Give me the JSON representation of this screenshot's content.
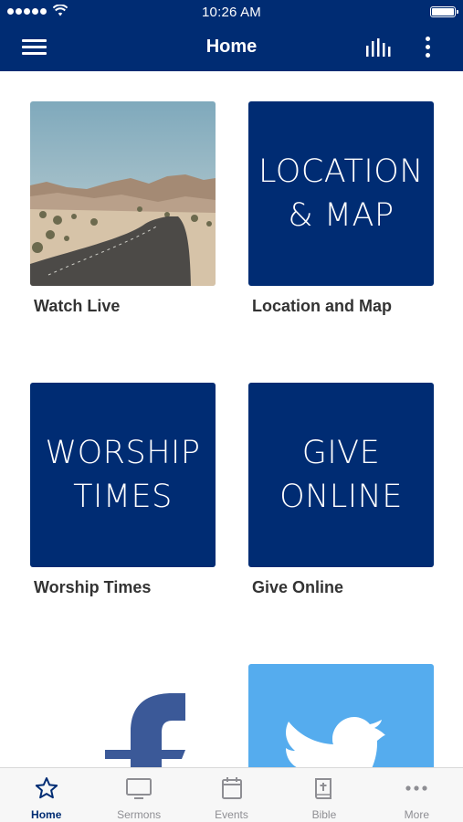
{
  "status_bar": {
    "time": "10:26 AM"
  },
  "nav": {
    "title": "Home"
  },
  "tiles": [
    {
      "label": "Watch Live",
      "image": "desert-road-photo"
    },
    {
      "label": "Location and Map",
      "text": "LOCATION\n& MAP"
    },
    {
      "label": "Worship Times",
      "text": "WORSHIP\nTIMES"
    },
    {
      "label": "Give Online",
      "text": "GIVE\nONLINE"
    },
    {
      "label": "",
      "image": "facebook-logo"
    },
    {
      "label": "",
      "image": "twitter-logo"
    }
  ],
  "tab_bar": {
    "items": [
      {
        "label": "Home",
        "icon": "star-icon",
        "active": true
      },
      {
        "label": "Sermons",
        "icon": "tv-icon",
        "active": false
      },
      {
        "label": "Events",
        "icon": "calendar-icon",
        "active": false
      },
      {
        "label": "Bible",
        "icon": "bible-icon",
        "active": false
      },
      {
        "label": "More",
        "icon": "ellipsis-icon",
        "active": false
      }
    ]
  },
  "colors": {
    "primary": "#002c73",
    "twitter": "#55acee",
    "facebook": "#3b5998",
    "tab_inactive": "#8e8e93",
    "label_text": "#333333"
  }
}
